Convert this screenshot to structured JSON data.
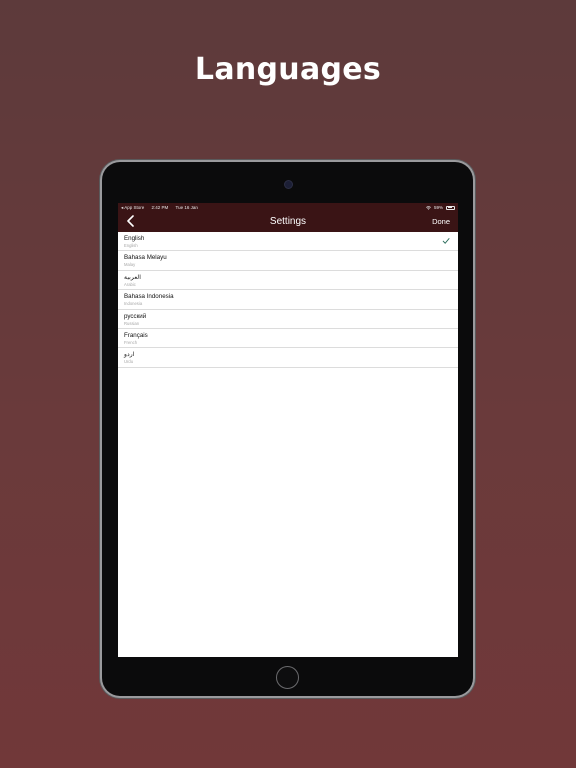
{
  "headline": "Languages",
  "status_bar": {
    "back_app": "◂ App Store",
    "time": "2:42 PM",
    "date": "Tue 16 Jan",
    "battery": "59%"
  },
  "navbar": {
    "title": "Settings",
    "done_label": "Done"
  },
  "languages": [
    {
      "name": "English",
      "subtitle": "English",
      "selected": true
    },
    {
      "name": "Bahasa Melayu",
      "subtitle": "Malay"
    },
    {
      "name": "العربية",
      "subtitle": "Arabic"
    },
    {
      "name": "Bahasa Indonesia",
      "subtitle": "Indonesia"
    },
    {
      "name": "русский",
      "subtitle": "Russian"
    },
    {
      "name": "Français",
      "subtitle": "French"
    },
    {
      "name": "اردو",
      "subtitle": "Urdu"
    }
  ],
  "colors": {
    "background": "#6a3a3b",
    "navbar": "#3a1415",
    "checkmark": "#2f6f5e"
  }
}
